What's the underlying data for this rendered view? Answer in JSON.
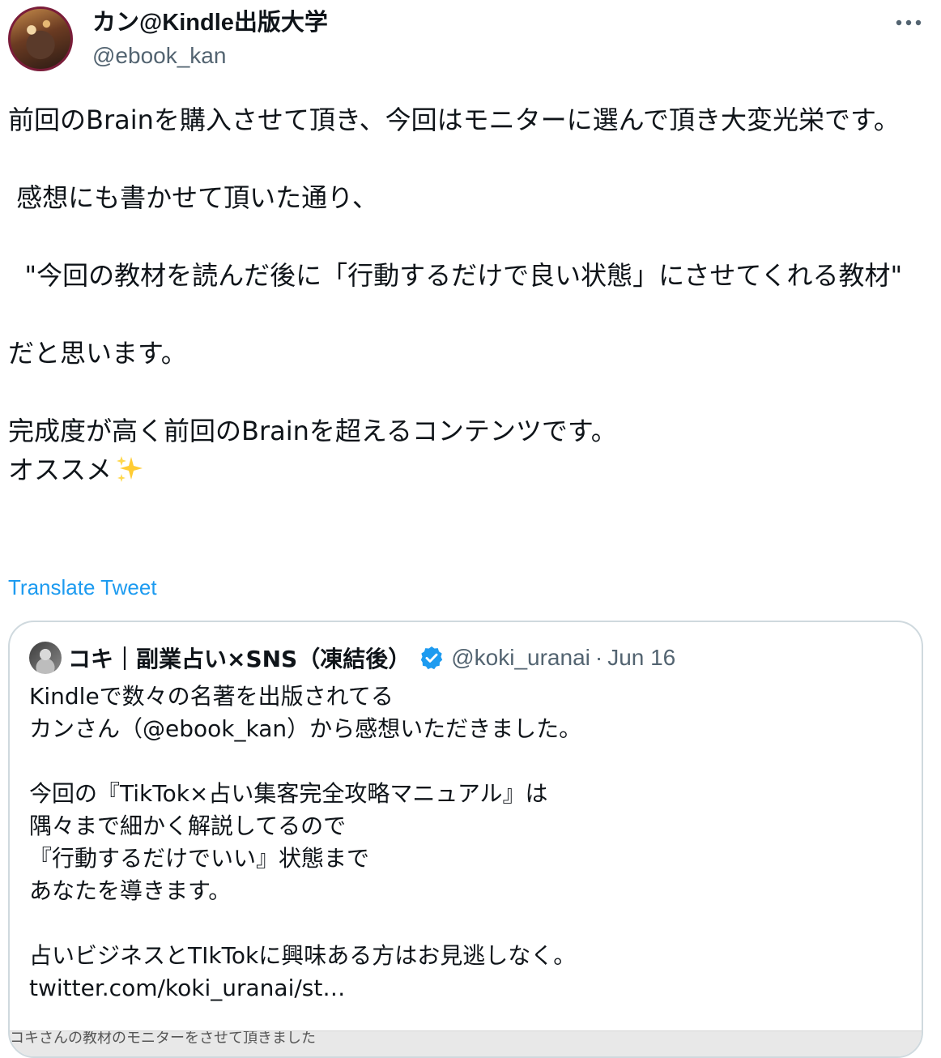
{
  "author": {
    "display_name": "カン@Kindle出版大学",
    "handle": "@ebook_kan",
    "avatar_icon": "profile-photo"
  },
  "menu": {
    "icon": "more-horizontal-icon"
  },
  "tweet": {
    "paragraphs": [
      "前回のBrainを購入させて頂き、今回はモニターに選んで頂き大変光栄です。",
      " 感想にも書かせて頂いた通り、",
      "  \"今回の教材を読んだ後に「行動するだけで良い状態」にさせてくれる教材\"",
      "だと思います。",
      "完成度が高く前回のBrainを超えるコンテンツです。",
      "オススメ"
    ],
    "emoji": "sparkles-emoji"
  },
  "translate": {
    "label": "Translate Tweet"
  },
  "quoted": {
    "display_name": "コキ｜副業占い×SNS（凍結後）",
    "verified": true,
    "handle": "@koki_uranai",
    "separator": "·",
    "date": "Jun 16",
    "lines": [
      "Kindleで数々の名著を出版されてる",
      "カンさん（@ebook_kan）から感想いただきました。",
      "",
      "今回の『TikTok×占い集客完全攻略マニュアル』は",
      "隅々まで細かく解説してるので",
      "『行動するだけでいい』状態まで",
      "あなたを導きます。",
      "",
      "占いビジネスとTIkTokに興味ある方はお見逃しなく。",
      "twitter.com/koki_uranai/st…"
    ],
    "image_caption": "コキさんの教材のモニターをさせて頂きました",
    "accent_color": "#1d9bf0"
  }
}
